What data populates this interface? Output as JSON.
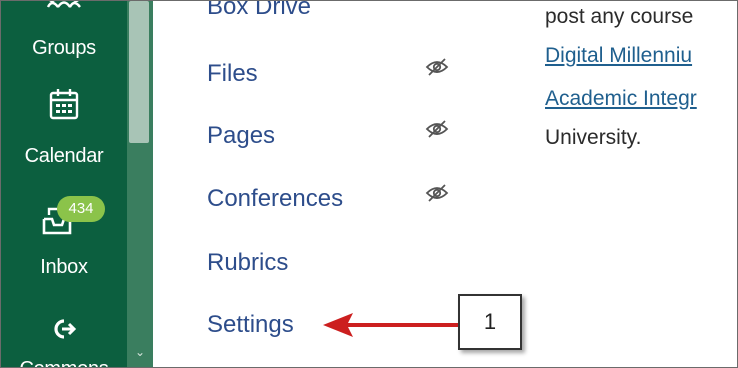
{
  "global_nav": {
    "items": [
      {
        "label": "Groups",
        "icon": "groups-icon"
      },
      {
        "label": "Calendar",
        "icon": "calendar-icon"
      },
      {
        "label": "Inbox",
        "icon": "inbox-icon",
        "badge": "434"
      },
      {
        "label": "Commons",
        "icon": "commons-icon"
      }
    ],
    "partial_label_top": "",
    "partial_label_bottom": "Commons"
  },
  "course_nav": {
    "items": [
      {
        "label": "Box Drive",
        "hidden": false
      },
      {
        "label": "Files",
        "hidden": true
      },
      {
        "label": "Pages",
        "hidden": true
      },
      {
        "label": "Conferences",
        "hidden": true
      },
      {
        "label": "Rubrics",
        "hidden": false
      },
      {
        "label": "Settings",
        "hidden": false
      }
    ]
  },
  "content": {
    "line1": "post any course",
    "link1": "Digital Millenniu",
    "link2": "Academic Integr",
    "line4": "University."
  },
  "callout": {
    "number": "1"
  },
  "colors": {
    "nav_bg": "#0c5f3f",
    "badge": "#8bc34a",
    "link": "#2d4d8b",
    "arrow": "#cc1f1f"
  }
}
